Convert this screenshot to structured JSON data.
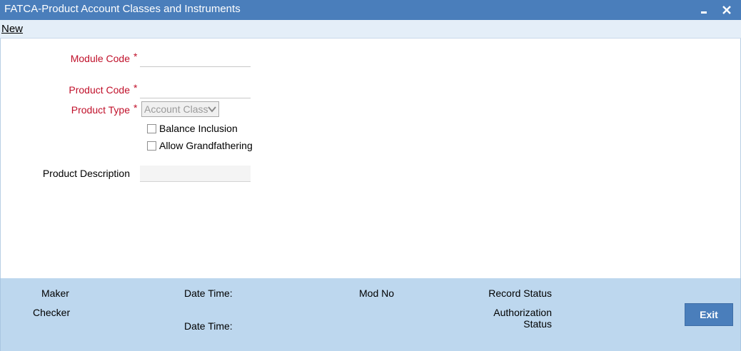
{
  "window": {
    "title": "FATCA-Product Account Classes and Instruments",
    "minimize_icon": "minimize-icon",
    "close_icon": "close-icon"
  },
  "toolbar": {
    "new_label": "New"
  },
  "form": {
    "module_code": {
      "label": "Module Code",
      "required_mark": "*",
      "value": ""
    },
    "product_code": {
      "label": "Product Code",
      "required_mark": "*",
      "value": ""
    },
    "product_type": {
      "label": "Product Type",
      "required_mark": "*",
      "selected": "Account Class"
    },
    "balance_inclusion": {
      "label": "Balance Inclusion",
      "checked": false
    },
    "allow_grandfathering": {
      "label": "Allow Grandfathering",
      "checked": false
    },
    "product_description": {
      "label": "Product Description",
      "value": ""
    }
  },
  "footer": {
    "maker_label": "Maker",
    "checker_label": "Checker",
    "date_time_label_1": "Date Time:",
    "date_time_label_2": "Date Time:",
    "mod_no_label": "Mod No",
    "record_status_label": "Record Status",
    "authorization_status_line1": "Authorization",
    "authorization_status_line2": "Status",
    "exit_label": "Exit"
  },
  "colors": {
    "titlebar": "#4a7ebb",
    "required_label": "#c0102a",
    "footer_bg": "#bdd7ee",
    "exit_button": "#4a7ebb"
  }
}
